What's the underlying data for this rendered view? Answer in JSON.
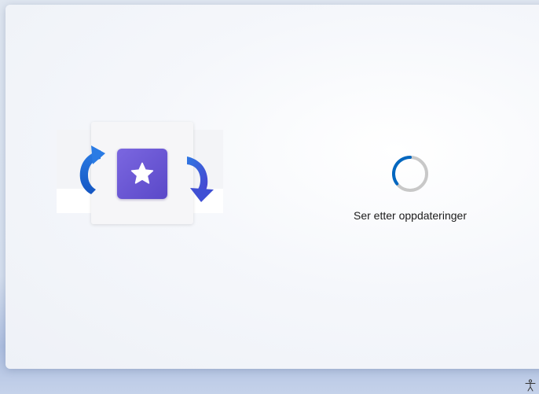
{
  "status": {
    "message": "Ser etter oppdateringer",
    "progress_indicator": "indeterminate"
  },
  "icons": {
    "illustration": "update-illustration",
    "arrows": "refresh-arrows-icon",
    "star": "star-icon",
    "spinner": "loading-spinner-icon",
    "accessibility": "accessibility-icon"
  },
  "colors": {
    "arrow_blue": "#1f6fd6",
    "tile_purple": "#6652d4",
    "spinner_accent": "#0067c0",
    "spinner_track": "#c8c8c8"
  }
}
